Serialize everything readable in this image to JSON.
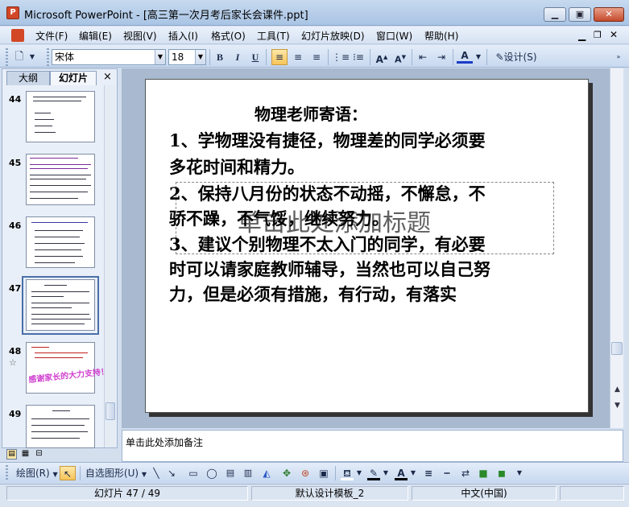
{
  "window": {
    "app_icon": "P",
    "title": "Microsoft PowerPoint - [高三第一次月考后家长会课件.ppt]",
    "controls": [
      "minimize-icon",
      "restore-icon",
      "close-icon"
    ],
    "doc_controls": [
      "doc-minimize-icon",
      "doc-restore-icon",
      "doc-close-icon"
    ]
  },
  "menu": {
    "items": [
      "文件(F)",
      "编辑(E)",
      "视图(V)",
      "插入(I)",
      "格式(O)",
      "工具(T)",
      "幻灯片放映(D)",
      "窗口(W)",
      "帮助(H)"
    ]
  },
  "toolbar": {
    "font_name": "宋体",
    "font_size": "18",
    "bold": "B",
    "italic": "I",
    "underline": "U",
    "increase_font": "A",
    "decrease_font": "A",
    "font_color": "A",
    "design_label": "设计(S)"
  },
  "left_panel": {
    "tabs": [
      "大纲",
      "幻灯片"
    ],
    "active_tab": "幻灯片",
    "close": "×",
    "slides": [
      {
        "number": "44"
      },
      {
        "number": "45"
      },
      {
        "number": "46"
      },
      {
        "number": "47",
        "selected": true
      },
      {
        "number": "48",
        "star": "☆",
        "thumb_text": "感谢家长的大力支持！"
      },
      {
        "number": "49"
      }
    ]
  },
  "slide": {
    "heading": "物理老师寄语：",
    "lines": [
      "1、学物理没有捷径，物理差的同学必须要",
      "多花时间和精力。",
      "2、保持八月份的状态不动摇，不懈怠，不",
      "骄不躁，不气馁，继续努力。",
      "3、建议个别物理不太入门的同学，有必要",
      "时可以请家庭教师辅导，当然也可以自己努",
      "力，但是必须有措施，有行动，有落实"
    ],
    "placeholder": "单击此处添加标题"
  },
  "notes": {
    "placeholder": "单击此处添加备注"
  },
  "draw_toolbar": {
    "draw_label": "绘图(R)",
    "autoshapes_label": "自选图形(U)"
  },
  "status": {
    "slide_info": "幻灯片 47 / 49",
    "template": "默认设计模板_2",
    "language": "中文(中国)"
  },
  "colors": {
    "title_bar": "#b8cfea",
    "toolbar": "#d6e2f2",
    "workspace": "#a8b9d0",
    "selected_thumb_border": "#4a6fa8"
  }
}
